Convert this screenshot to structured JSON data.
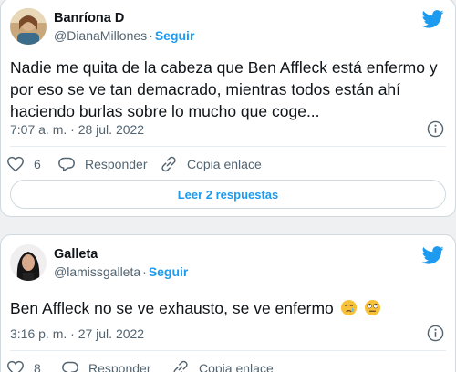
{
  "tweets": [
    {
      "author_name": "Banríona D",
      "handle": "@DianaMillones",
      "follow_label": "Seguir",
      "text": "Nadie me quita de la cabeza que Ben Affleck está enfermo y por eso se ve tan demacrado, mientras todos están ahí haciendo burlas sobre lo mucho que coge...",
      "timestamp": "7:07 a. m. · 28 jul. 2022",
      "like_count": "6",
      "reply_label": "Responder",
      "copy_link_label": "Copia enlace",
      "read_replies_label": "Leer 2 respuestas"
    },
    {
      "author_name": "Galleta",
      "handle": "@lamissgalleta",
      "follow_label": "Seguir",
      "text": "Ben Affleck no se ve exhausto, se ve enfermo",
      "emojis": [
        "crying-face-icon",
        "rolling-eyes-face-icon"
      ],
      "timestamp": "3:16 p. m. · 27 jul. 2022",
      "like_count": "8",
      "reply_label": "Responder",
      "copy_link_label": "Copia enlace"
    }
  ],
  "colors": {
    "twitter_blue": "#1d9bf0",
    "text": "#0f1419",
    "secondary": "#536471",
    "border": "#cfd9de"
  }
}
